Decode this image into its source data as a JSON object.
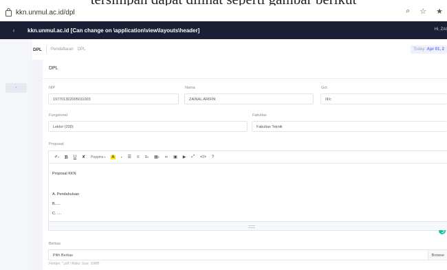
{
  "doc_caption": "tersimpan dapat dilihat seperti gambar berikut",
  "browser": {
    "url": "kkn.unmul.ac.id/dpl",
    "icons": [
      "lock-icon",
      "zoom-icon",
      "star-icon",
      "pin-icon"
    ]
  },
  "header": {
    "app_title": "kkn.unmul.ac.id [Can change on \\application\\view\\layouts\\header]",
    "user_greeting": "Hi, ZAI",
    "back_icon": "chevron-left-icon"
  },
  "sidebar": {
    "item_icon": "chevron-left-icon",
    "item_glyph": "‹"
  },
  "breadcrumb": {
    "title": "DPL",
    "links": [
      "Pendaftaran",
      "DPL"
    ],
    "today_label": "Today:",
    "today_value": "Apr 01, 2"
  },
  "card": {
    "title": "DPL"
  },
  "form": {
    "nip": {
      "label": "NIP",
      "value": "197701302005011003"
    },
    "nama": {
      "label": "Nama",
      "value": "ZAINAL ARIFIN"
    },
    "gol": {
      "label": "Gol.",
      "value": "III/c"
    },
    "fungsional": {
      "label": "Fungsional",
      "value": "Lektor (200)"
    },
    "fakultas": {
      "label": "Fakultas",
      "value": "Fakultas Teknik"
    },
    "proposal": {
      "label": "Proposal",
      "toolbar_font": "Poppins",
      "lines": [
        "Proposal KKN",
        "A. Pendahuluan",
        "B.....",
        "C. ...."
      ]
    },
    "berkas": {
      "label": "Berkas",
      "placeholder": "Pilih Berkas",
      "browse_label": "Browse",
      "hint": "Filetipe: *.pdf | Maks. Size: 10MB"
    }
  },
  "colors": {
    "header_bg": "#1b1f36",
    "accent": "#5d78ff",
    "grammarly": "#15c39a",
    "highlight": "#ffe600"
  }
}
